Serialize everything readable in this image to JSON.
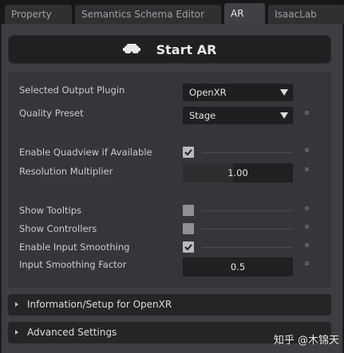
{
  "tabs": [
    {
      "label": "Property",
      "active": false
    },
    {
      "label": "Semantics Schema Editor",
      "active": false
    },
    {
      "label": "AR",
      "active": true
    },
    {
      "label": "IsaacLab",
      "active": false
    }
  ],
  "start_button": {
    "label": "Start AR",
    "icon": "vr-headset-icon"
  },
  "settings": {
    "output_plugin": {
      "label": "Selected Output Plugin",
      "value": "OpenXR"
    },
    "quality_preset": {
      "label": "Quality Preset",
      "value": "Stage"
    },
    "quadview": {
      "label": "Enable Quadview if Available",
      "checked": true
    },
    "resolution_multiplier": {
      "label": "Resolution Multiplier",
      "value": "1.00",
      "fill_fraction": 0.46
    },
    "show_tooltips": {
      "label": "Show Tooltips",
      "checked": false
    },
    "show_controllers": {
      "label": "Show Controllers",
      "checked": false
    },
    "input_smoothing": {
      "label": "Enable Input Smoothing",
      "checked": true
    },
    "smoothing_factor": {
      "label": "Input Smoothing Factor",
      "value": "0.5",
      "fill_fraction": 0.0
    }
  },
  "sections": [
    {
      "label": "Information/Setup for OpenXR",
      "expanded": false
    },
    {
      "label": "Advanced Settings",
      "expanded": false
    }
  ],
  "watermark": "知乎 @木锦天",
  "colors": {
    "panel": "#3c3e41",
    "field": "#1f2021",
    "accent_text": "#e8e9ea"
  }
}
